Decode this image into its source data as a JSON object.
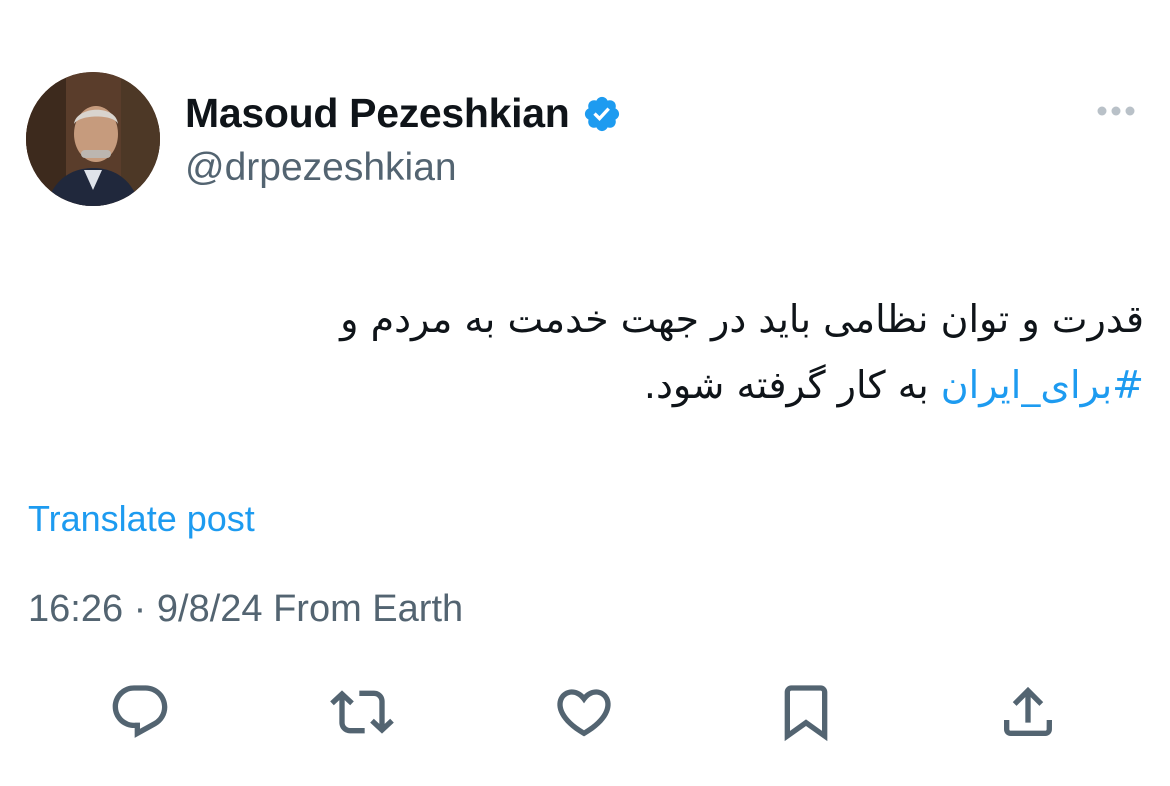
{
  "author": {
    "display_name": "Masoud Pezeshkian",
    "handle": "@drpezeshkian",
    "verified": true
  },
  "post": {
    "text_before_hashtag": "قدرت و توان نظامی باید در جهت خدمت به مردم و ",
    "hashtag": "#برای_ایران",
    "text_after_hashtag": " به کار گرفته شود.",
    "translate_label": "Translate post",
    "time": "16:26",
    "date": "9/8/24",
    "separator": " · ",
    "source": "From Earth"
  },
  "actions": [
    {
      "name": "reply",
      "icon": "reply-icon"
    },
    {
      "name": "repost",
      "icon": "repost-icon"
    },
    {
      "name": "like",
      "icon": "heart-icon"
    },
    {
      "name": "bookmark",
      "icon": "bookmark-icon"
    },
    {
      "name": "share",
      "icon": "share-icon"
    }
  ],
  "colors": {
    "text": "#0f1419",
    "secondary": "#536471",
    "accent": "#1d9bf0",
    "icon": "#536471"
  }
}
